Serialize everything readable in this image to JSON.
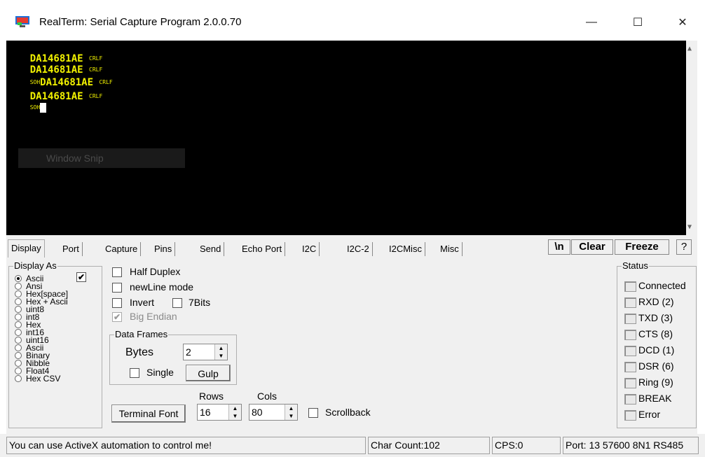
{
  "window": {
    "title": "RealTerm: Serial Capture Program 2.0.0.70",
    "minimize": "—",
    "maximize": "☐",
    "close": "✕"
  },
  "terminal": {
    "lines": [
      {
        "prefix": "",
        "text": "DA14681AE",
        "ctrl": "CRLF"
      },
      {
        "prefix": "",
        "text": "DA14681AE",
        "ctrl": "CRLF"
      },
      {
        "prefix": "SOH",
        "text": "DA14681AE",
        "ctrl": "CRLF"
      },
      {
        "prefix": "",
        "text": "DA14681AE",
        "ctrl": "CRLF"
      },
      {
        "prefix": "SOH",
        "text": "",
        "ctrl": ""
      }
    ],
    "overlay": "Window Snip"
  },
  "tabs": [
    {
      "label": "Display",
      "active": true
    },
    {
      "label": "Port"
    },
    {
      "label": "Capture"
    },
    {
      "label": "Pins"
    },
    {
      "label": "Send"
    },
    {
      "label": "Echo Port"
    },
    {
      "label": "I2C"
    },
    {
      "label": "I2C-2"
    },
    {
      "label": "I2CMisc"
    },
    {
      "label": "Misc"
    }
  ],
  "toolbar": {
    "newline": "\\n",
    "clear": "Clear",
    "freeze": "Freeze",
    "help": "?"
  },
  "display_as": {
    "label": "Display As",
    "selected": "Ascii",
    "options": [
      "Ascii",
      "Ansi",
      "Hex[space]",
      "Hex + Ascii",
      "uint8",
      "int8",
      "Hex",
      "int16",
      "uint16",
      "Ascii",
      "Binary",
      "Nibble",
      "Float4",
      "Hex CSV"
    ],
    "check": "✔"
  },
  "options": {
    "half_duplex": "Half Duplex",
    "newline_mode": "newLine mode",
    "invert": "Invert",
    "seven_bits": "7Bits",
    "big_endian": "Big Endian",
    "big_endian_checked": true
  },
  "data_frames": {
    "label": "Data Frames",
    "bytes_label": "Bytes",
    "bytes_value": "2",
    "single": "Single",
    "gulp": "Gulp"
  },
  "terminal_settings": {
    "font_button": "Terminal Font",
    "rows_label": "Rows",
    "rows_value": "16",
    "cols_label": "Cols",
    "cols_value": "80",
    "scrollback": "Scrollback"
  },
  "status": {
    "label": "Status",
    "items": [
      "Connected",
      "RXD (2)",
      "TXD (3)",
      "CTS (8)",
      "DCD (1)",
      "DSR (6)",
      "Ring (9)",
      "BREAK",
      "Error"
    ]
  },
  "statusbar": {
    "message": "You can use ActiveX automation to control me!",
    "char_count": "Char Count:102",
    "cps": "CPS:0",
    "port": "Port: 13 57600 8N1 RS485"
  }
}
